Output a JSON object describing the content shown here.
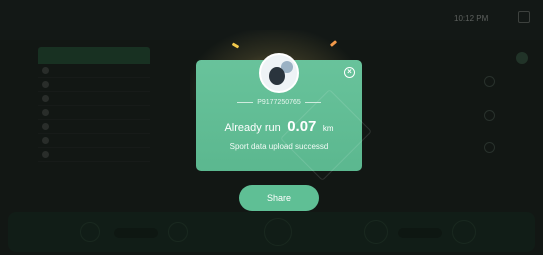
{
  "topbar": {
    "logo_text": "",
    "clock": "10:12 PM"
  },
  "modal": {
    "user_id": "P9177250765",
    "run_prefix": "Already run",
    "distance": "0.07",
    "distance_unit": "km",
    "upload_status": "Sport data upload successd",
    "close_icon": "close-icon",
    "avatar_icon": "avatar"
  },
  "share": {
    "label": "Share"
  },
  "colors": {
    "accent": "#5fbf95",
    "background": "#222a26",
    "overlay": "rgba(0,0,0,0.45)"
  }
}
